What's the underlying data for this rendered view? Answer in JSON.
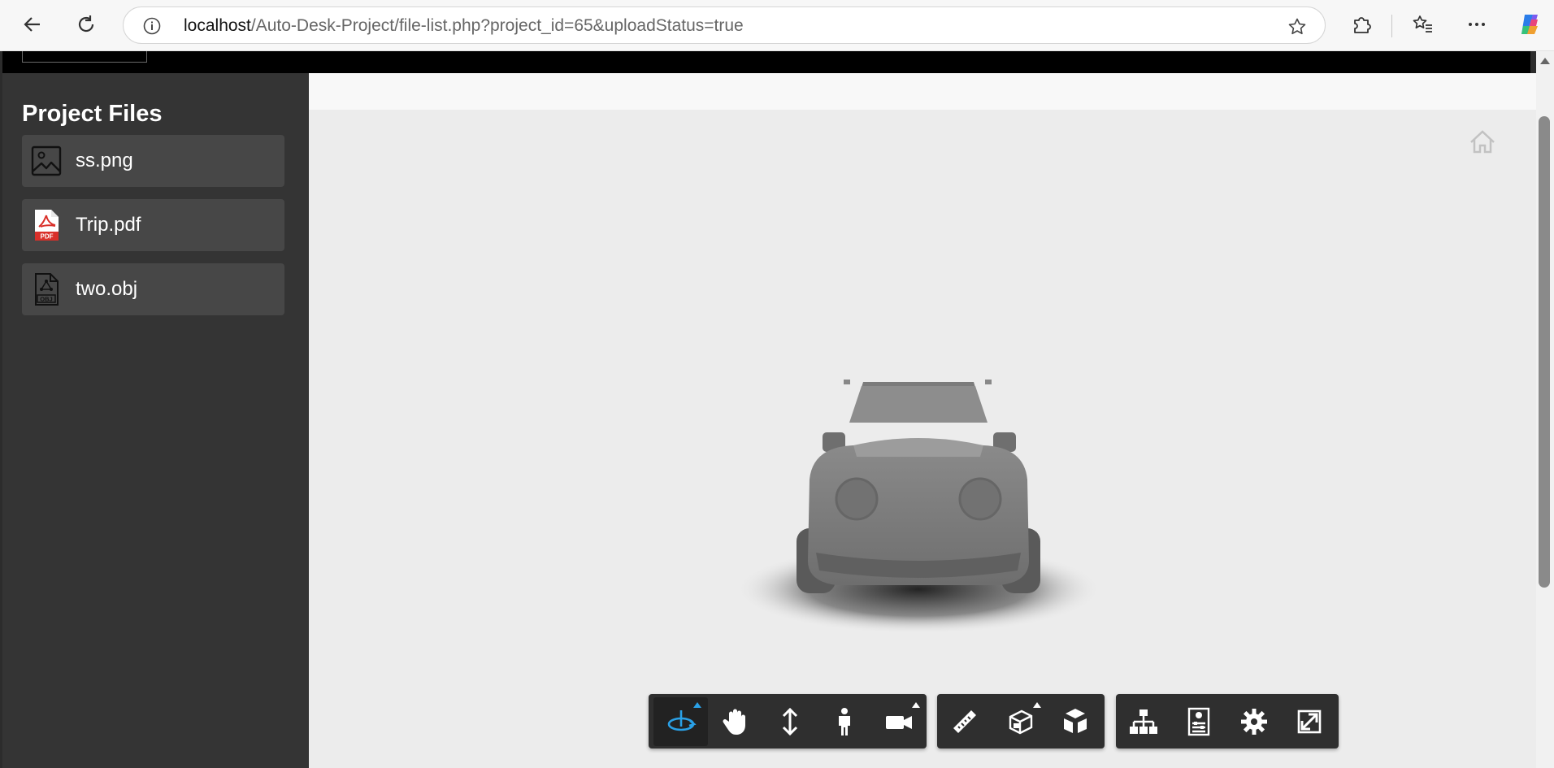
{
  "browser": {
    "url_host": "localhost",
    "url_path": "/Auto-Desk-Project/file-list.php?project_id=65&uploadStatus=true"
  },
  "sidebar": {
    "title": "Project Files",
    "files": [
      {
        "name": "ss.png",
        "icon": "image-file-icon"
      },
      {
        "name": "Trip.pdf",
        "icon": "pdf-file-icon",
        "badge": "PDF"
      },
      {
        "name": "two.obj",
        "icon": "obj-file-icon",
        "badge": "OBJ"
      }
    ]
  },
  "viewer": {
    "accent_color": "#2aa0e6",
    "toolbar": {
      "navigation": [
        "orbit-icon",
        "pan-icon",
        "zoom-icon",
        "first-person-icon",
        "camera-icon"
      ],
      "modeling": [
        "measure-icon",
        "section-icon",
        "explode-icon"
      ],
      "settings": [
        "model-browser-icon",
        "properties-icon",
        "settings-icon",
        "fullscreen-icon"
      ]
    }
  }
}
